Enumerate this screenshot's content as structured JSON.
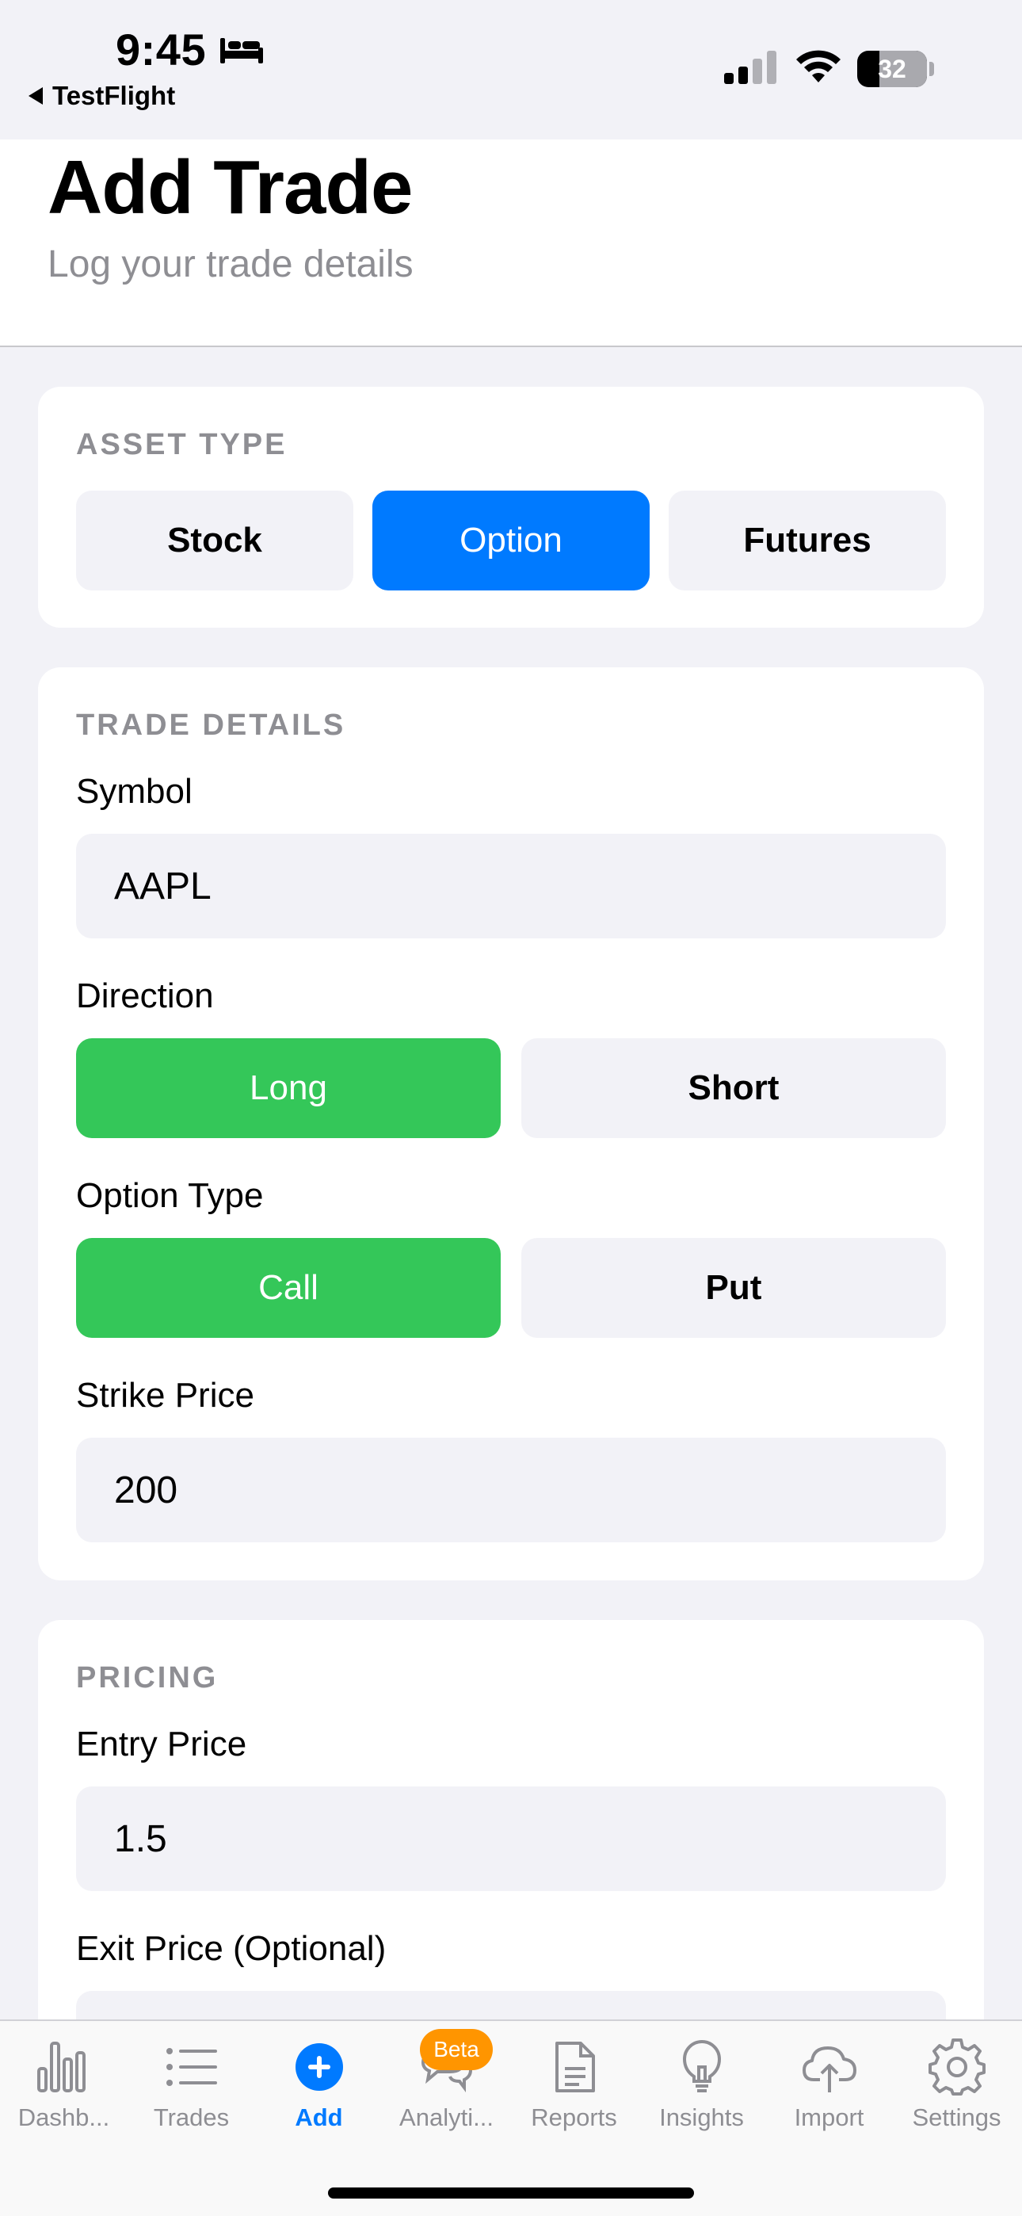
{
  "status_bar": {
    "time": "9:45",
    "back_app": "TestFlight",
    "battery": "32",
    "battery_level": 0.32
  },
  "header": {
    "title": "Add Trade",
    "subtitle": "Log your trade details"
  },
  "asset_type": {
    "section_title": "ASSET TYPE",
    "options": [
      "Stock",
      "Option",
      "Futures"
    ],
    "selected": "Option"
  },
  "trade_details": {
    "section_title": "TRADE DETAILS",
    "symbol_label": "Symbol",
    "symbol_value": "AAPL",
    "direction_label": "Direction",
    "direction_options": [
      "Long",
      "Short"
    ],
    "direction_selected": "Long",
    "option_type_label": "Option Type",
    "option_type_options": [
      "Call",
      "Put"
    ],
    "option_type_selected": "Call",
    "strike_label": "Strike Price",
    "strike_value": "200"
  },
  "pricing": {
    "section_title": "PRICING",
    "entry_label": "Entry Price",
    "entry_value": "1.5",
    "exit_label": "Exit Price (Optional)",
    "exit_value": ""
  },
  "tab_bar": {
    "items": [
      {
        "label": "Dashb...",
        "icon": "bar-chart-icon"
      },
      {
        "label": "Trades",
        "icon": "list-icon"
      },
      {
        "label": "Add",
        "icon": "plus-circle-icon"
      },
      {
        "label": "Analyti...",
        "icon": "chat-bubbles-icon"
      },
      {
        "label": "Reports",
        "icon": "document-icon"
      },
      {
        "label": "Insights",
        "icon": "lightbulb-icon"
      },
      {
        "label": "Import",
        "icon": "cloud-upload-icon"
      },
      {
        "label": "Settings",
        "icon": "gear-icon"
      }
    ],
    "active": "Add",
    "badge": "Beta"
  },
  "colors": {
    "accent_blue": "#007aff",
    "accent_green": "#34c759",
    "badge_orange": "#ff9500",
    "background": "#f2f2f7"
  }
}
